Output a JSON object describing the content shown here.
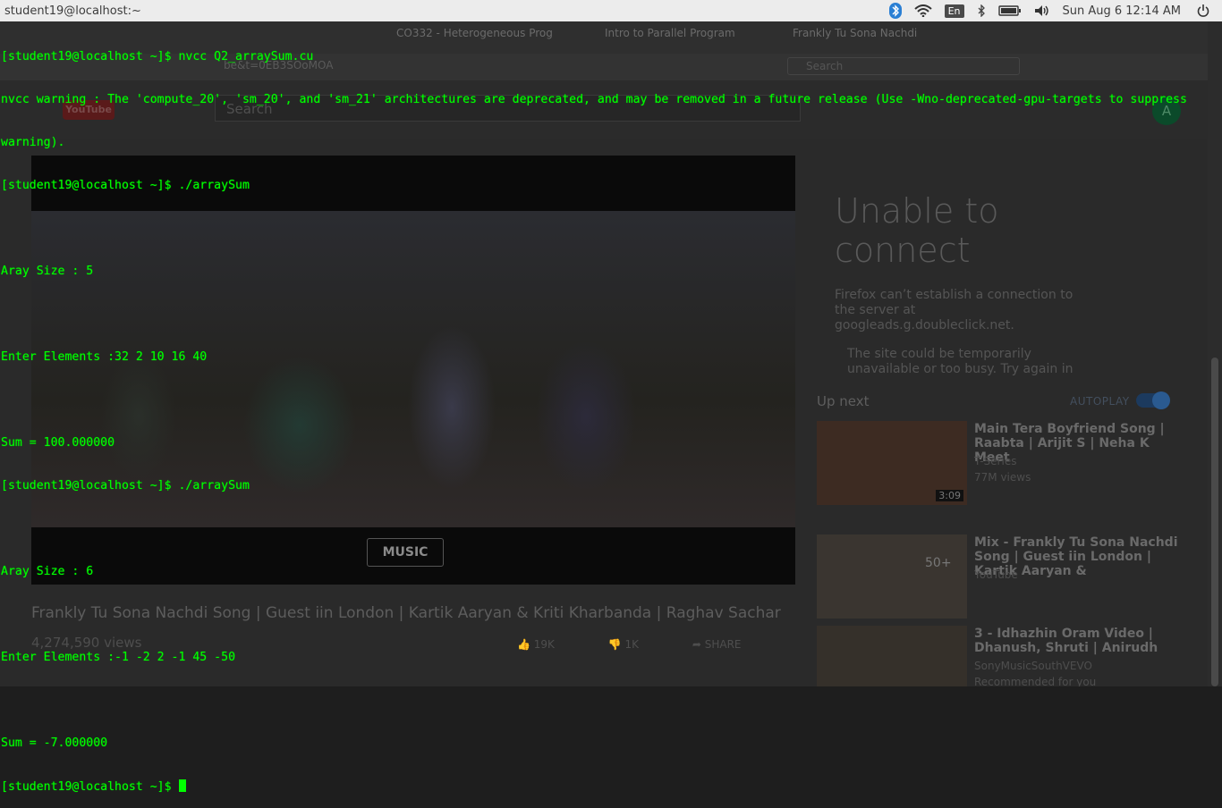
{
  "topbar": {
    "title": "student19@localhost:~",
    "lang": "En",
    "clock": "Sun Aug  6 12:14 AM"
  },
  "background": {
    "tabs": [
      "CO332 - Heterogeneous Prog",
      "Intro to Parallel Program",
      "Frankly Tu Sona Nachdi"
    ],
    "url_fragment": "be&t=0EB3SOoMOA",
    "search_placeholder": "Search",
    "yt_logo": "YouTube",
    "yt_search_placeholder": "Search",
    "avatar_initial": "A",
    "music_badge": "MUSIC",
    "error_title": "Unable to connect",
    "error_message": "Firefox can’t establish a connection to the server at googleads.g.doubleclick.net.",
    "error_bullet": "The site could be temporarily unavailable or too busy. Try again in",
    "upnext_label": "Up next",
    "autoplay_label": "AUTOPLAY",
    "recommendations": [
      {
        "title": "Main Tera Boyfriend Song | Raabta | Arijit S | Neha K Meet",
        "channel": "T-Series",
        "meta": "77M views",
        "duration": "3:09"
      },
      {
        "title": "Mix - Frankly Tu Sona Nachdi Song | Guest iin London | Kartik Aaryan &",
        "channel": "YouTube",
        "meta": "",
        "duration": "50+"
      },
      {
        "title": "3 - Idhazhin Oram Video | Dhanush, Shruti | Anirudh",
        "channel": "SonyMusicSouthVEVO",
        "meta": "Recommended for you",
        "duration": ""
      }
    ],
    "video_title": "Frankly Tu Sona Nachdi Song | Guest iin London | Kartik Aaryan & Kriti Kharbanda | Raghav Sachar",
    "video_views": "4,274,590 views",
    "likes": "19K",
    "dislikes": "1K",
    "share_label": "SHARE"
  },
  "terminal": {
    "lines": [
      "[student19@localhost ~]$ nvcc Q2_arraySum.cu",
      "nvcc warning : The 'compute_20', 'sm_20', and 'sm_21' architectures are deprecated, and may be removed in a future release (Use -Wno-deprecated-gpu-targets to suppress",
      "warning).",
      "[student19@localhost ~]$ ./arraySum",
      "",
      "Aray Size : 5",
      "",
      "Enter Elements :32 2 10 16 40",
      "",
      "Sum = 100.000000",
      "[student19@localhost ~]$ ./arraySum",
      "",
      "Aray Size : 6",
      "",
      "Enter Elements :-1 -2 2 -1 45 -50",
      "",
      "Sum = -7.000000"
    ],
    "prompt": "[student19@localhost ~]$ "
  }
}
